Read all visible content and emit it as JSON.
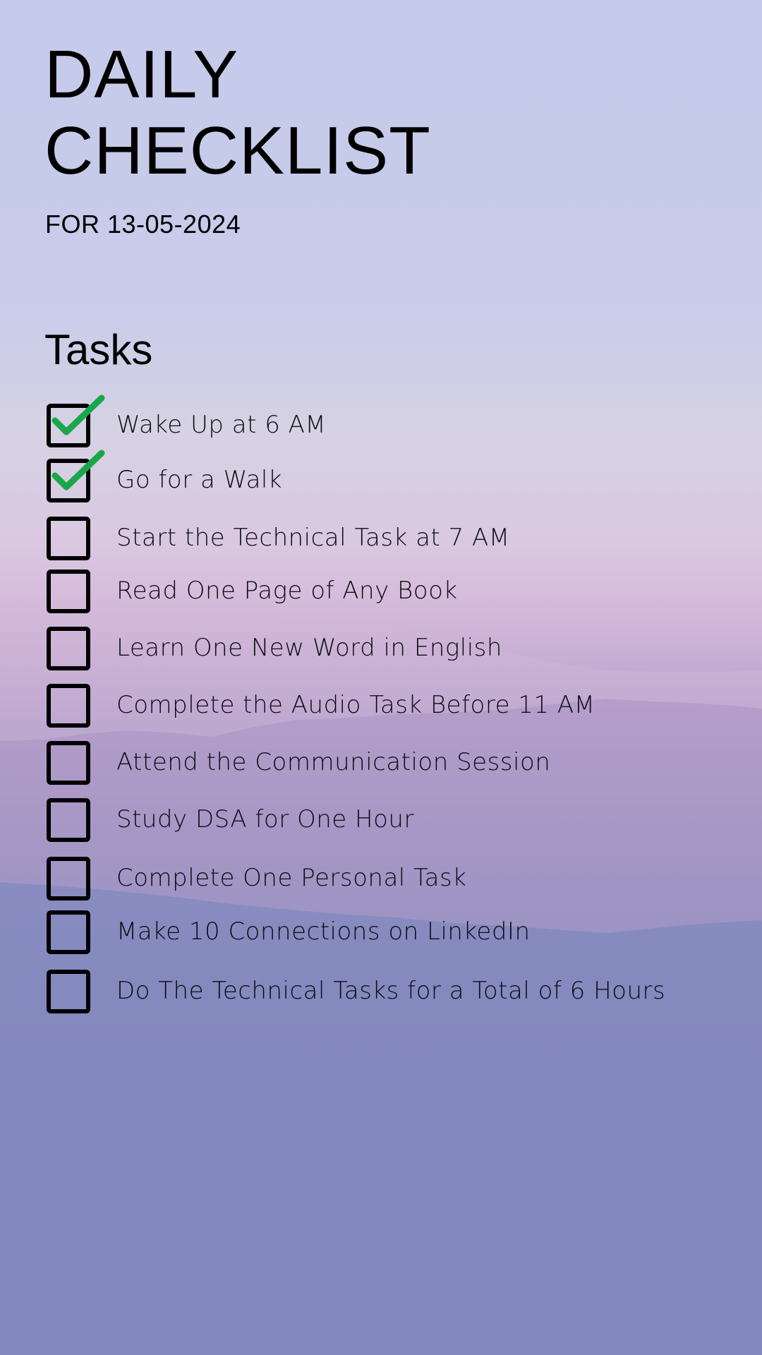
{
  "header": {
    "title_line1": "DAILY",
    "title_line2": "CHECKLIST",
    "subtitle": "FOR 13-05-2024"
  },
  "section": {
    "title": "Tasks"
  },
  "tasks": [
    {
      "label": "Wake Up at 6 AM",
      "checked": true
    },
    {
      "label": "Go for a Walk",
      "checked": true
    },
    {
      "label": "Start the Technical Task at 7 AM",
      "checked": false
    },
    {
      "label": "Read One Page of Any Book",
      "checked": false
    },
    {
      "label": "Learn One New Word in English",
      "checked": false
    },
    {
      "label": "Complete the Audio Task Before 11 AM",
      "checked": false
    },
    {
      "label": "Attend the Communication Session",
      "checked": false
    },
    {
      "label": "Study DSA for One Hour",
      "checked": false
    },
    {
      "label": "Complete One Personal Task",
      "checked": false
    },
    {
      "label": "Make 10 Connections on LinkedIn",
      "checked": false
    },
    {
      "label": "Do The Technical Tasks for a Total of 6 Hours",
      "checked": false
    }
  ],
  "colors": {
    "check": "#1aa64a",
    "checkbox_border": "#000000",
    "text": "#0d0d14"
  },
  "icons": {
    "checkbox": "checkbox-icon",
    "checkmark": "checkmark-icon"
  }
}
